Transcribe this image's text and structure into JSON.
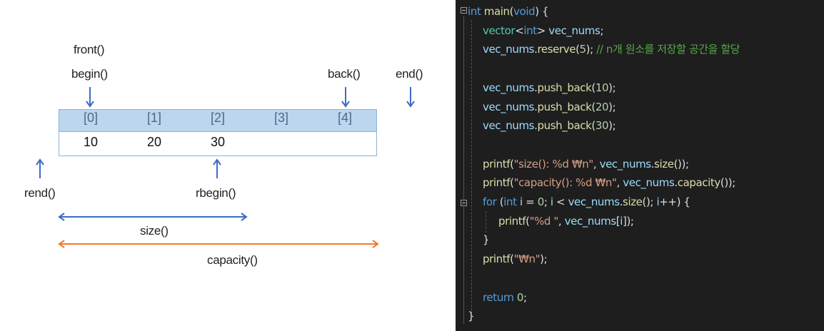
{
  "diagram": {
    "labels": {
      "front": "front()",
      "begin": "begin()",
      "back": "back()",
      "end": "end()",
      "rend": "rend()",
      "rbegin": "rbegin()",
      "size": "size()",
      "capacity": "capacity()"
    },
    "indices": [
      "[0]",
      "[1]",
      "[2]",
      "[3]",
      "[4]"
    ],
    "values": [
      "10",
      "20",
      "30",
      "",
      ""
    ],
    "colors": {
      "header_fill": "#bcd6ee",
      "pointer_arrow": "#3d6cc4",
      "size_arrow": "#3d6cc4",
      "capacity_arrow": "#f07a2e"
    }
  },
  "code": {
    "lines": [
      [
        {
          "t": "int",
          "c": "kw"
        },
        {
          "t": " "
        },
        {
          "t": "main",
          "c": "fn"
        },
        {
          "t": "("
        },
        {
          "t": "void",
          "c": "kw"
        },
        {
          "t": ") {"
        }
      ],
      [
        {
          "t": "vector",
          "c": "ty"
        },
        {
          "t": "<"
        },
        {
          "t": "int",
          "c": "kw"
        },
        {
          "t": "> "
        },
        {
          "t": "vec_nums",
          "c": "va"
        },
        {
          "t": ";"
        }
      ],
      [
        {
          "t": "vec_nums",
          "c": "va"
        },
        {
          "t": "."
        },
        {
          "t": "reserve",
          "c": "fn"
        },
        {
          "t": "("
        },
        {
          "t": "5",
          "c": "nm"
        },
        {
          "t": "); "
        },
        {
          "t": "// n개 원소를 저장할 공간을 할당",
          "c": "cm"
        }
      ],
      [],
      [
        {
          "t": "vec_nums",
          "c": "va"
        },
        {
          "t": "."
        },
        {
          "t": "push_back",
          "c": "fn"
        },
        {
          "t": "("
        },
        {
          "t": "10",
          "c": "nm"
        },
        {
          "t": ");"
        }
      ],
      [
        {
          "t": "vec_nums",
          "c": "va"
        },
        {
          "t": "."
        },
        {
          "t": "push_back",
          "c": "fn"
        },
        {
          "t": "("
        },
        {
          "t": "20",
          "c": "nm"
        },
        {
          "t": ");"
        }
      ],
      [
        {
          "t": "vec_nums",
          "c": "va"
        },
        {
          "t": "."
        },
        {
          "t": "push_back",
          "c": "fn"
        },
        {
          "t": "("
        },
        {
          "t": "30",
          "c": "nm"
        },
        {
          "t": ");"
        }
      ],
      [],
      [
        {
          "t": "printf",
          "c": "fn"
        },
        {
          "t": "("
        },
        {
          "t": "\"size(): %d ₩n\"",
          "c": "st"
        },
        {
          "t": ", "
        },
        {
          "t": "vec_nums",
          "c": "va"
        },
        {
          "t": "."
        },
        {
          "t": "size",
          "c": "fn"
        },
        {
          "t": "());"
        }
      ],
      [
        {
          "t": "printf",
          "c": "fn"
        },
        {
          "t": "("
        },
        {
          "t": "\"capacity(): %d ₩n\"",
          "c": "st"
        },
        {
          "t": ", "
        },
        {
          "t": "vec_nums",
          "c": "va"
        },
        {
          "t": "."
        },
        {
          "t": "capacity",
          "c": "fn"
        },
        {
          "t": "());"
        }
      ],
      [
        {
          "t": "for",
          "c": "kw"
        },
        {
          "t": " ("
        },
        {
          "t": "int",
          "c": "kw"
        },
        {
          "t": " "
        },
        {
          "t": "i",
          "c": "va"
        },
        {
          "t": " = "
        },
        {
          "t": "0",
          "c": "nm"
        },
        {
          "t": "; "
        },
        {
          "t": "i",
          "c": "va"
        },
        {
          "t": " < "
        },
        {
          "t": "vec_nums",
          "c": "va"
        },
        {
          "t": "."
        },
        {
          "t": "size",
          "c": "fn"
        },
        {
          "t": "(); "
        },
        {
          "t": "i",
          "c": "va"
        },
        {
          "t": "++) {"
        }
      ],
      [
        {
          "t": "printf",
          "c": "fn"
        },
        {
          "t": "("
        },
        {
          "t": "\"%d \"",
          "c": "st"
        },
        {
          "t": ", "
        },
        {
          "t": "vec_nums",
          "c": "va"
        },
        {
          "t": "["
        },
        {
          "t": "i",
          "c": "va"
        },
        {
          "t": "]);"
        }
      ],
      [
        {
          "t": "}"
        }
      ],
      [
        {
          "t": "printf",
          "c": "fn"
        },
        {
          "t": "("
        },
        {
          "t": "\"₩n\"",
          "c": "st"
        },
        {
          "t": ");"
        }
      ],
      [],
      [
        {
          "t": "return",
          "c": "kw"
        },
        {
          "t": " "
        },
        {
          "t": "0",
          "c": "nm"
        },
        {
          "t": ";"
        }
      ],
      [
        {
          "t": "}"
        }
      ]
    ]
  }
}
